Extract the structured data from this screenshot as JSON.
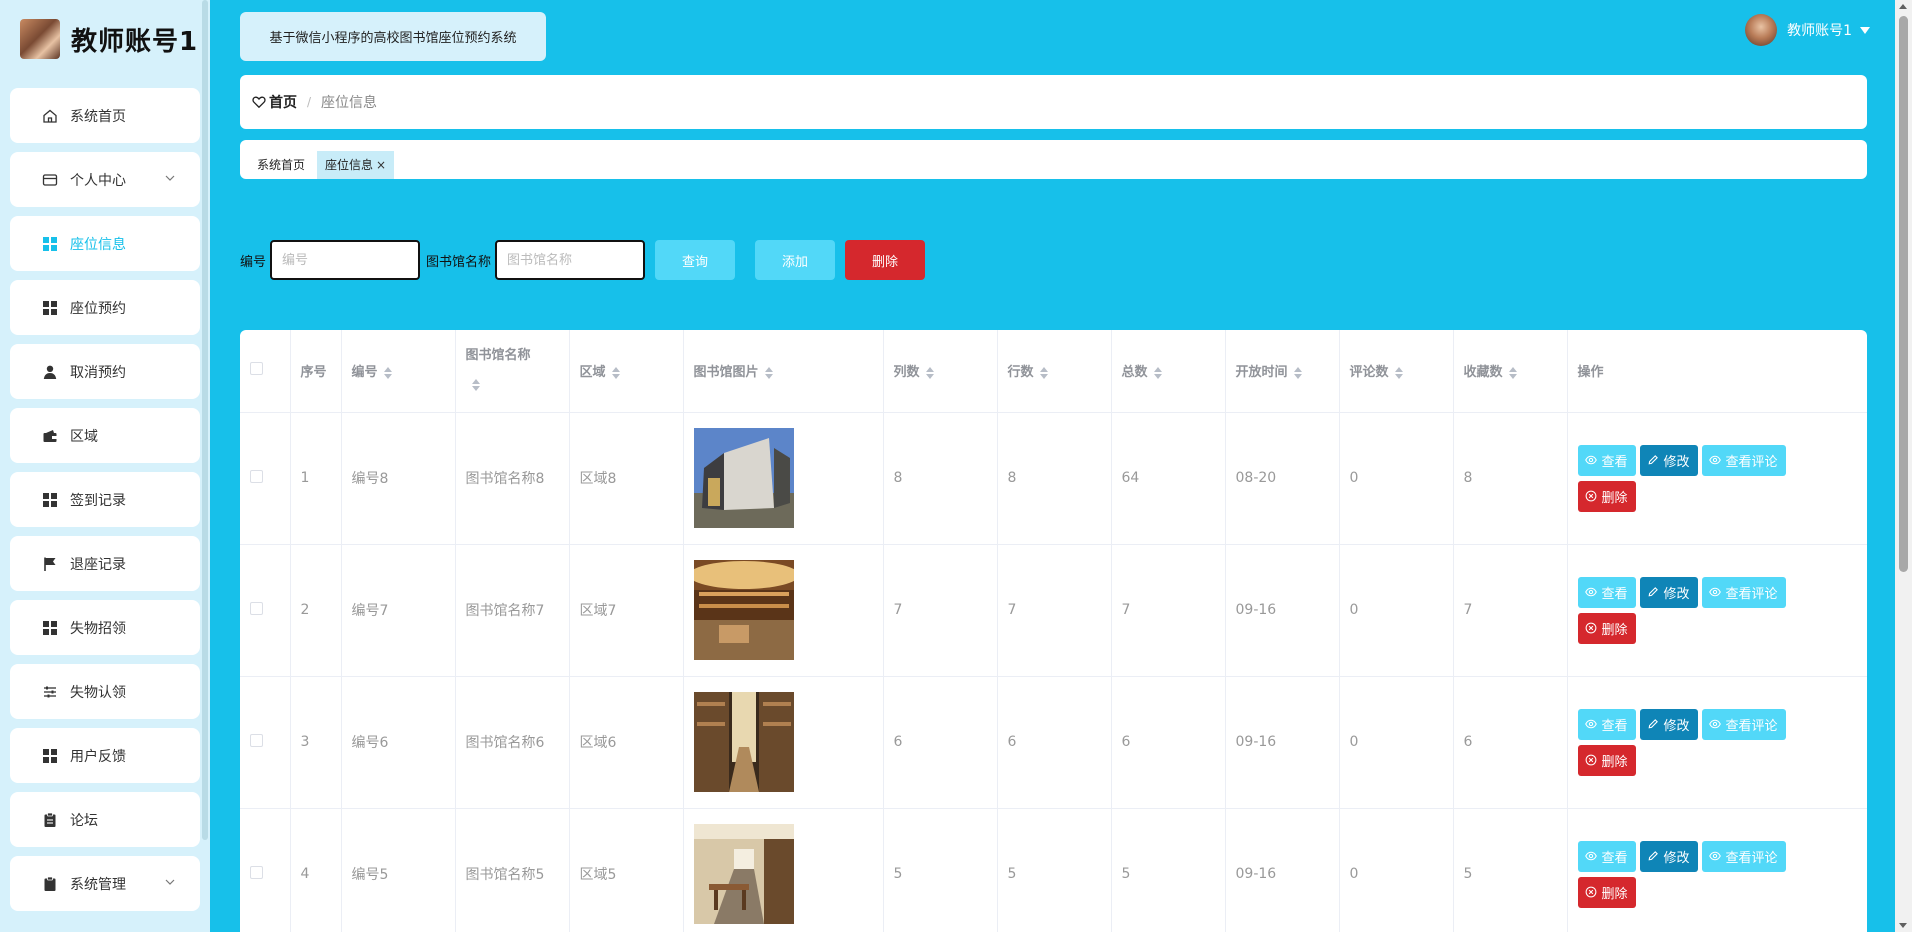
{
  "brand": {
    "title": "教师账号1"
  },
  "sidebar": {
    "items": [
      {
        "label": "系统首页",
        "icon": "home-icon"
      },
      {
        "label": "个人中心",
        "icon": "card-icon"
      },
      {
        "label": "座位信息",
        "icon": "grid-icon"
      },
      {
        "label": "座位预约",
        "icon": "grid-icon"
      },
      {
        "label": "取消预约",
        "icon": "user-icon"
      },
      {
        "label": "区域",
        "icon": "wallet-icon"
      },
      {
        "label": "签到记录",
        "icon": "grid-icon"
      },
      {
        "label": "退座记录",
        "icon": "flag-icon"
      },
      {
        "label": "失物招领",
        "icon": "grid-icon"
      },
      {
        "label": "失物认领",
        "icon": "sliders-icon"
      },
      {
        "label": "用户反馈",
        "icon": "grid-icon"
      },
      {
        "label": "论坛",
        "icon": "clipboard-icon"
      },
      {
        "label": "系统管理",
        "icon": "clipboard-icon"
      }
    ]
  },
  "header": {
    "system_title": "基于微信小程序的高校图书馆座位预约系统",
    "user_name": "教师账号1"
  },
  "breadcrumb": {
    "home": "首页",
    "separator": "/",
    "current": "座位信息"
  },
  "tags": {
    "home": "系统首页",
    "current": "座位信息",
    "close": "×"
  },
  "search": {
    "number_label": "编号",
    "number_placeholder": "编号",
    "name_label": "图书馆名称",
    "name_placeholder": "图书馆名称",
    "query_label": "查询",
    "add_label": "添加",
    "delete_label": "删除"
  },
  "table": {
    "headers": {
      "index": "序号",
      "number": "编号",
      "name": "图书馆名称",
      "area": "区域",
      "image": "图书馆图片",
      "cols": "列数",
      "rows": "行数",
      "total": "总数",
      "open_time": "开放时间",
      "comments": "评论数",
      "favorites": "收藏数",
      "actions": "操作"
    },
    "rows": [
      {
        "index": "1",
        "number": "编号8",
        "name": "图书馆名称8",
        "area": "区域8",
        "cols": "8",
        "rows": "8",
        "total": "64",
        "open_time": "08-20",
        "comments": "0",
        "favorites": "8"
      },
      {
        "index": "2",
        "number": "编号7",
        "name": "图书馆名称7",
        "area": "区域7",
        "cols": "7",
        "rows": "7",
        "total": "7",
        "open_time": "09-16",
        "comments": "0",
        "favorites": "7"
      },
      {
        "index": "3",
        "number": "编号6",
        "name": "图书馆名称6",
        "area": "区域6",
        "cols": "6",
        "rows": "6",
        "total": "6",
        "open_time": "09-16",
        "comments": "0",
        "favorites": "6"
      },
      {
        "index": "4",
        "number": "编号5",
        "name": "图书馆名称5",
        "area": "区域5",
        "cols": "5",
        "rows": "5",
        "total": "5",
        "open_time": "09-16",
        "comments": "0",
        "favorites": "5"
      }
    ],
    "actions": {
      "view": "查看",
      "edit": "修改",
      "view_comments": "查看评论",
      "delete": "删除"
    }
  },
  "colors": {
    "accent": "#17c0ea",
    "sidebar_bg": "#d6f1fb",
    "danger": "#d5282d",
    "edit": "#0f85b7",
    "light_button": "#52d8f8"
  }
}
